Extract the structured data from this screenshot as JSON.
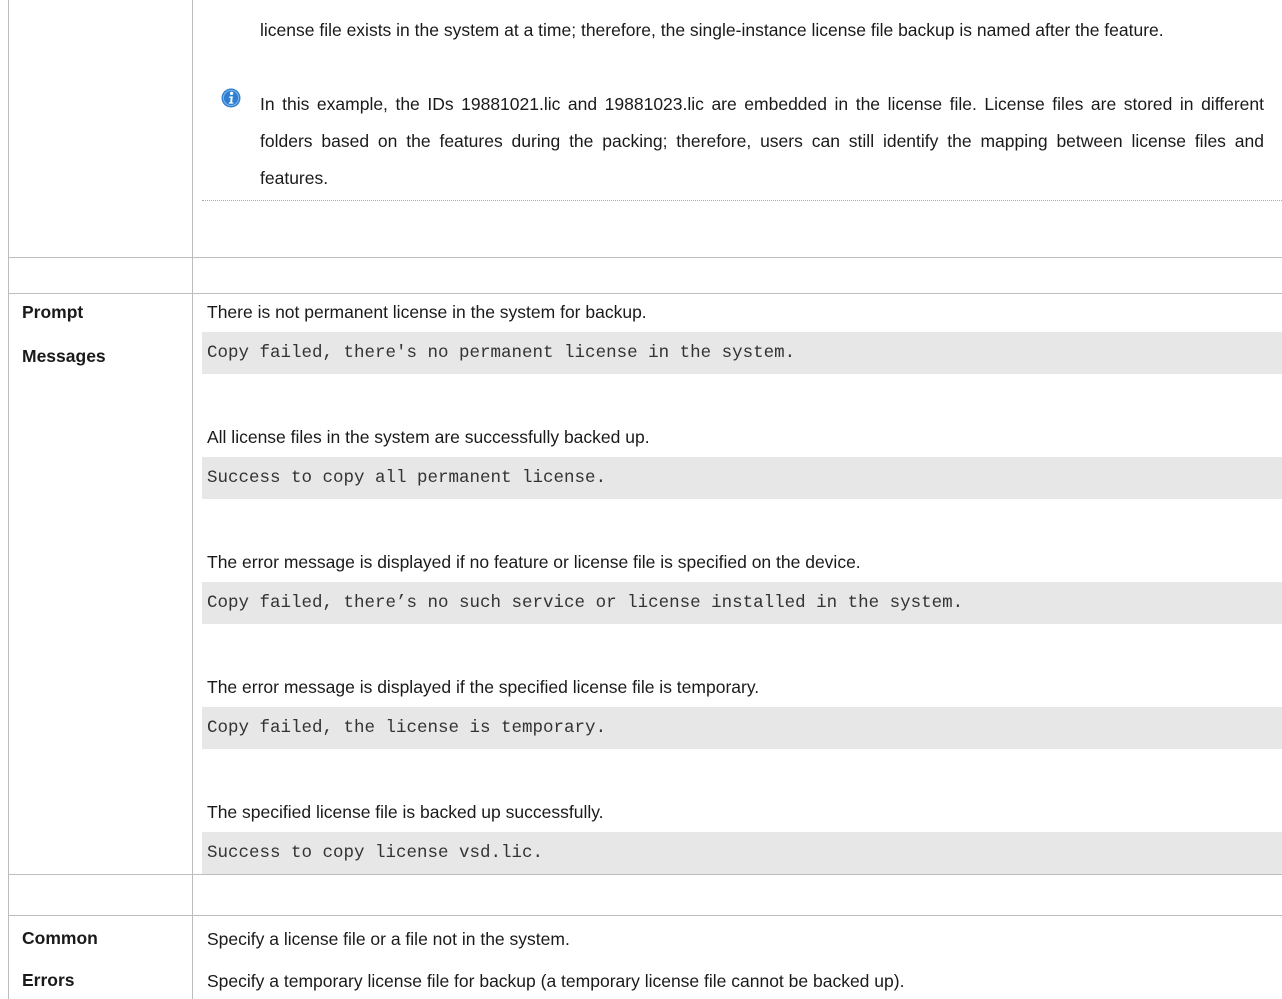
{
  "usage_guide": {
    "paragraph_1": "license file exists in the system at a time; therefore, the single-instance license file backup is named after the feature.",
    "note": "In this example, the IDs 19881021.lic and 19881023.lic are embedded in the license file. License files are stored in different folders based on the features during the packing; therefore, users can still identify the mapping between license files and features."
  },
  "prompt_messages": {
    "label_line1": "Prompt",
    "label_line2": "Messages",
    "items": [
      {
        "description": "There is not permanent license in the system for backup.",
        "code": "Copy failed, there's no permanent license in the system."
      },
      {
        "description": "All license files in the system are successfully backed up.",
        "code": "Success to copy all permanent license."
      },
      {
        "description": "The error message is displayed if no feature or license file is specified on the device.",
        "code": "Copy failed, there’s no such service or license installed in the system."
      },
      {
        "description": "The error message is displayed if the specified license file is temporary.",
        "code": "Copy failed, the license is temporary."
      },
      {
        "description": "The specified license file is backed up successfully.",
        "code": "Success to copy license vsd.lic."
      }
    ]
  },
  "common_errors": {
    "label_line1": "Common",
    "label_line2": "Errors",
    "items": [
      "Specify a license file or a file not in the system.",
      "Specify a temporary license file for backup (a temporary license file cannot be backed up)."
    ]
  },
  "colors": {
    "border": "#bdbdbd",
    "code_background": "#e7e7e7",
    "info_icon": "#2f7fd1"
  },
  "icons": {
    "note": "info-icon"
  }
}
